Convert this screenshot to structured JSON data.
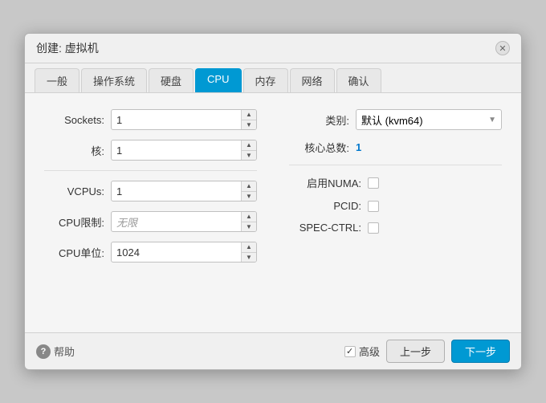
{
  "dialog": {
    "title": "创建: 虚拟机",
    "close_label": "✕"
  },
  "tabs": [
    {
      "id": "general",
      "label": "一般",
      "active": false
    },
    {
      "id": "os",
      "label": "操作系统",
      "active": false
    },
    {
      "id": "disk",
      "label": "硬盘",
      "active": false
    },
    {
      "id": "cpu",
      "label": "CPU",
      "active": true
    },
    {
      "id": "memory",
      "label": "内存",
      "active": false
    },
    {
      "id": "network",
      "label": "网络",
      "active": false
    },
    {
      "id": "confirm",
      "label": "确认",
      "active": false
    }
  ],
  "form": {
    "left": {
      "sockets_label": "Sockets:",
      "sockets_value": "1",
      "cores_label": "核:",
      "cores_value": "1",
      "vcpus_label": "VCPUs:",
      "vcpus_value": "1",
      "cpu_limit_label": "CPU限制:",
      "cpu_limit_value": "无限",
      "cpu_unit_label": "CPU单位:",
      "cpu_unit_value": "1024"
    },
    "right": {
      "category_label": "类别:",
      "category_value": "默认 (kvm64)",
      "cores_total_label": "核心总数:",
      "cores_total_value": "1",
      "numa_label": "启用NUMA:",
      "pcid_label": "PCID:",
      "spec_ctrl_label": "SPEC-CTRL:"
    }
  },
  "footer": {
    "help_label": "帮助",
    "advanced_label": "高级",
    "back_label": "上一步",
    "next_label": "下一步"
  },
  "icons": {
    "up_arrow": "▲",
    "down_arrow": "▼",
    "select_arrow": "▼",
    "help": "?",
    "close": "✕",
    "check": "✓"
  }
}
